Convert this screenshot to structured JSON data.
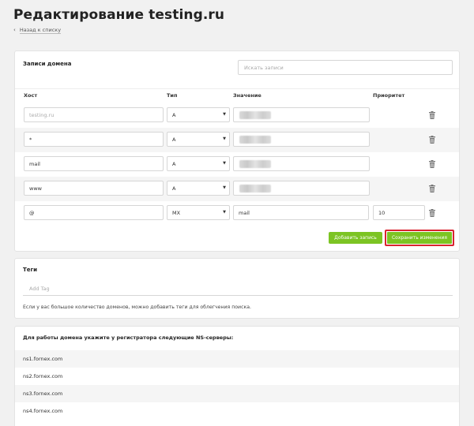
{
  "page": {
    "title": "Редактирование testing.ru",
    "back_label": "Назад к списку"
  },
  "records": {
    "title": "Записи домена",
    "search_placeholder": "Искать записи",
    "columns": {
      "host": "Хост",
      "type": "Тип",
      "value": "Значение",
      "priority": "Приоритет"
    },
    "rows": [
      {
        "host": "testing.ru",
        "host_is_placeholder": true,
        "type": "A",
        "value": "",
        "value_blurred": true,
        "priority": ""
      },
      {
        "host": "*",
        "type": "A",
        "value": "",
        "value_blurred": true,
        "priority": ""
      },
      {
        "host": "mail",
        "type": "A",
        "value": "",
        "value_blurred": true,
        "priority": ""
      },
      {
        "host": "www",
        "type": "A",
        "value": "",
        "value_blurred": true,
        "priority": ""
      },
      {
        "host": "@",
        "type": "MX",
        "value": "mail",
        "value_blurred": false,
        "priority": "10"
      }
    ],
    "add_button": "Добавить запись",
    "save_button": "Сохранить изменения"
  },
  "tags": {
    "title": "Теги",
    "input_placeholder": "Add Tag",
    "hint": "Если у вас большое количество доменов, можно добавить теги для облегчения поиска."
  },
  "ns": {
    "title": "Для работы домена укажите у регистратора следующие NS-серверы:",
    "servers": [
      "ns1.fornex.com",
      "ns2.fornex.com",
      "ns3.fornex.com",
      "ns4.fornex.com"
    ]
  },
  "colors": {
    "accent_green": "#7cc423",
    "highlight_red": "#d9232e"
  },
  "icons": {
    "back": "chevron-left-icon",
    "delete": "trash-icon",
    "select": "caret-down-icon"
  }
}
